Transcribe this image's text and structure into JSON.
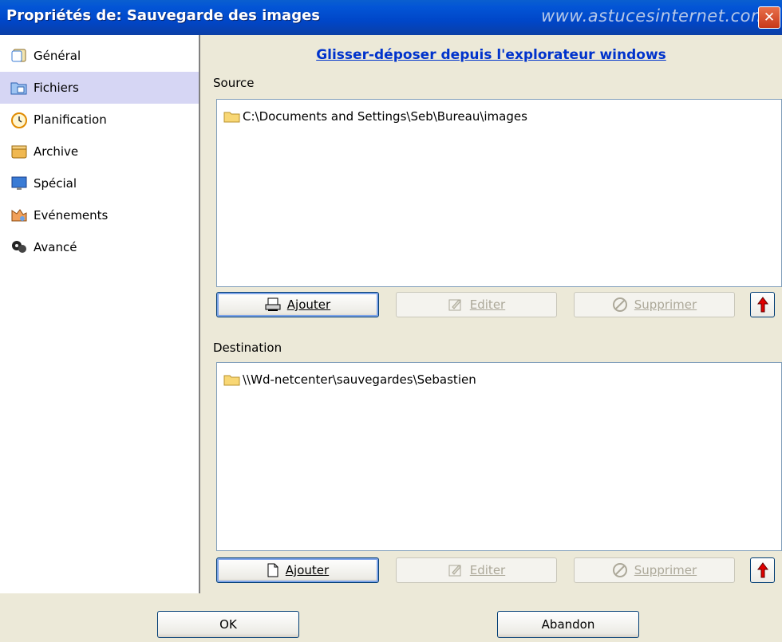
{
  "window": {
    "title": "Propriétés de: Sauvegarde des images",
    "watermark": "www.astucesinternet.com",
    "close": "✕"
  },
  "sidebar": {
    "items": [
      {
        "label": "Général",
        "icon": "general-icon"
      },
      {
        "label": "Fichiers",
        "icon": "files-icon",
        "selected": true
      },
      {
        "label": "Planification",
        "icon": "clock-icon"
      },
      {
        "label": "Archive",
        "icon": "archive-icon"
      },
      {
        "label": "Spécial",
        "icon": "monitor-icon"
      },
      {
        "label": "Evénements",
        "icon": "events-icon"
      },
      {
        "label": "Avancé",
        "icon": "advanced-icon"
      }
    ]
  },
  "main": {
    "hint": "Glisser-déposer depuis l'explorateur windows",
    "source": {
      "label": "Source",
      "items": [
        "C:\\Documents and Settings\\Seb\\Bureau\\images"
      ],
      "add": "Ajouter",
      "edit": "Editer",
      "delete": "Supprimer"
    },
    "destination": {
      "label": "Destination",
      "items": [
        "\\\\Wd-netcenter\\sauvegardes\\Sebastien"
      ],
      "add": "Ajouter",
      "edit": "Editer",
      "delete": "Supprimer"
    }
  },
  "footer": {
    "ok": "OK",
    "cancel": "Abandon"
  },
  "colors": {
    "titlebar": "#0046c8",
    "link": "#0033cc",
    "selected_item": "#d6d6f4",
    "window_bg": "#ece9d8",
    "up_arrow": "#e00000"
  }
}
